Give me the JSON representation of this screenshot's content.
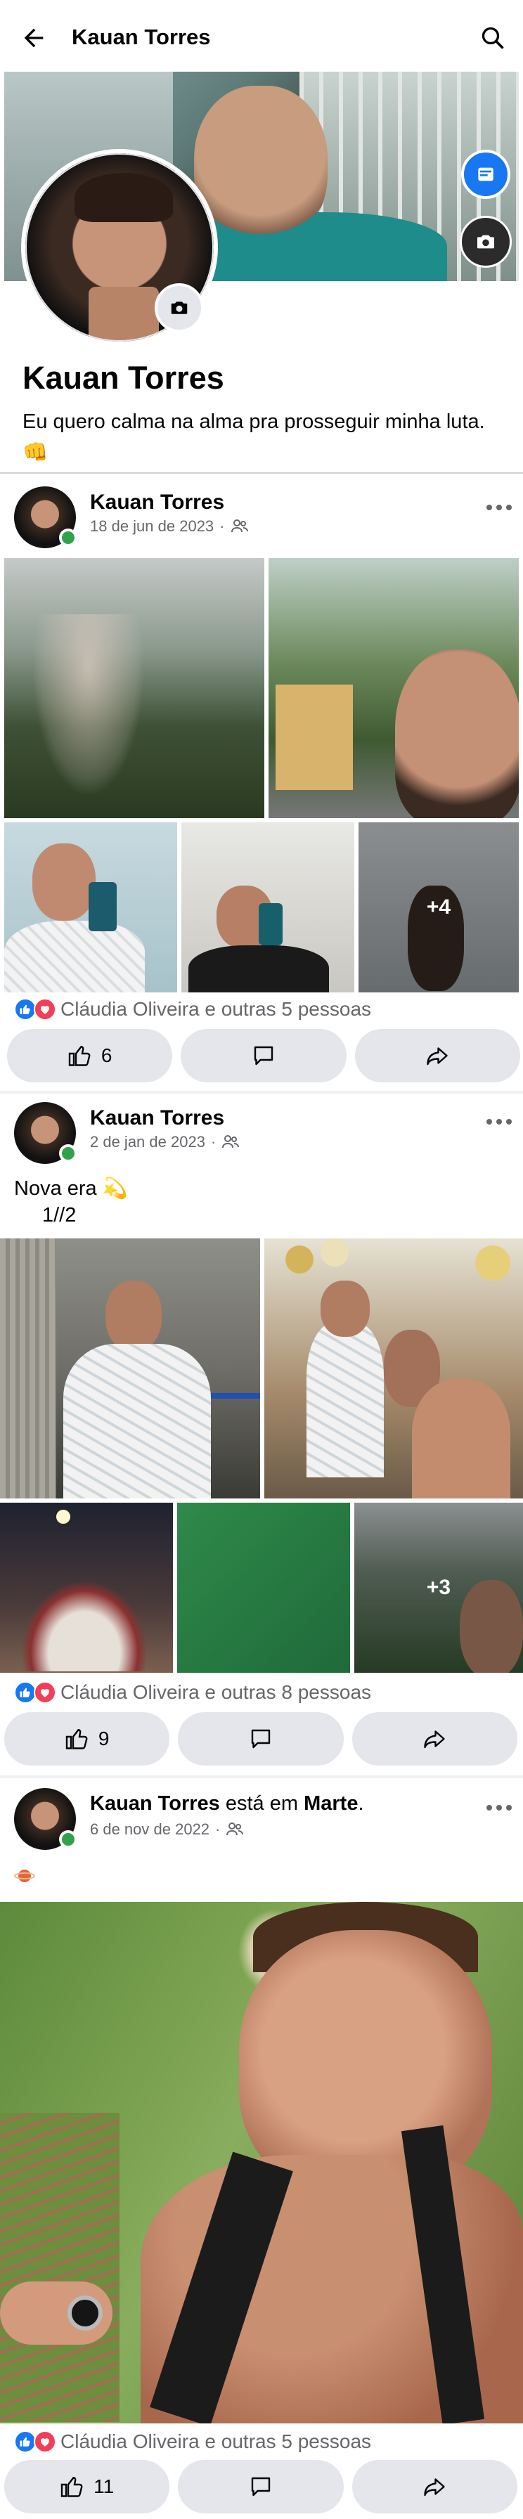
{
  "topbar": {
    "title": "Kauan Torres"
  },
  "profile": {
    "name": "Kauan Torres",
    "bio_text": "Eu quero calma na alma pra prosseguir minha luta.",
    "bio_emoji": "👊"
  },
  "posts": [
    {
      "author": "Kauan Torres",
      "date": "18 de jun de 2023",
      "dot": "·",
      "extra_photos": "+4",
      "reactions_text": "Cláudia Oliveira e outras 5 pessoas",
      "like_count": "6"
    },
    {
      "author": "Kauan Torres",
      "date": "2 de jan de 2023",
      "dot": "·",
      "text_line1": "Nova era",
      "text_emoji": "💫",
      "text_line2": "1//2",
      "extra_photos": "+3",
      "reactions_text": "Cláudia Oliveira e outras 8 pessoas",
      "like_count": "9"
    },
    {
      "author": "Kauan Torres",
      "checkin_verb": "está em",
      "checkin_place": "Marte",
      "checkin_end": ".",
      "date": "6 de nov de 2022",
      "dot": "·",
      "reactions_text": "Cláudia Oliveira e outras 5 pessoas",
      "like_count": "11"
    }
  ],
  "colors": {
    "accent": "#1877f2",
    "online": "#31a24c",
    "love": "#f33e58",
    "button_bg": "#e4e6eb",
    "meta_text": "#65676b"
  },
  "icons": [
    "back-arrow-icon",
    "search-icon",
    "edit-cover-icon",
    "camera-icon",
    "friends-audience-icon",
    "more-icon",
    "like-icon",
    "love-icon",
    "comment-icon",
    "share-icon"
  ]
}
